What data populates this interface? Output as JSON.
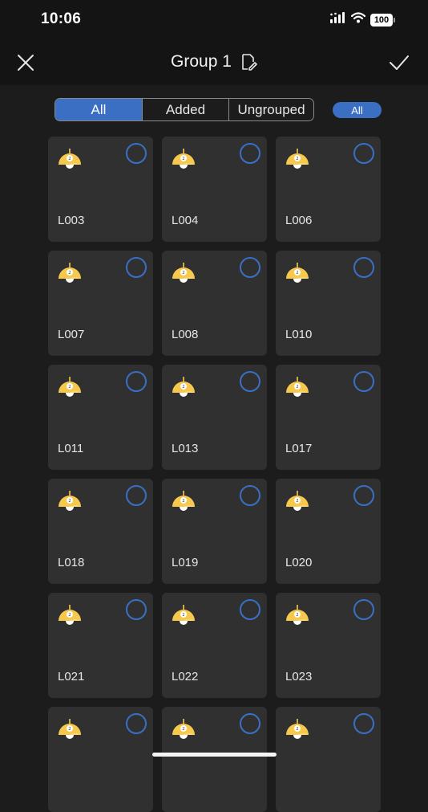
{
  "status_bar": {
    "time": "10:06",
    "battery": "100",
    "icons": [
      "signal-icon",
      "wifi-icon",
      "battery-icon"
    ]
  },
  "header": {
    "title": "Group 1",
    "left_icon": "close-icon",
    "title_icon": "edit-icon",
    "right_icon": "check-icon"
  },
  "filter": {
    "tabs": [
      {
        "label": "All",
        "active": true
      },
      {
        "label": "Added",
        "active": false
      },
      {
        "label": "Ungrouped",
        "active": false
      }
    ],
    "scope_label": "All"
  },
  "devices": [
    {
      "name": "L003",
      "selected": false
    },
    {
      "name": "L004",
      "selected": false
    },
    {
      "name": "L006",
      "selected": false
    },
    {
      "name": "L007",
      "selected": false
    },
    {
      "name": "L008",
      "selected": false
    },
    {
      "name": "L010",
      "selected": false
    },
    {
      "name": "L011",
      "selected": false
    },
    {
      "name": "L013",
      "selected": false
    },
    {
      "name": "L017",
      "selected": false
    },
    {
      "name": "L018",
      "selected": false
    },
    {
      "name": "L019",
      "selected": false
    },
    {
      "name": "L020",
      "selected": false
    },
    {
      "name": "L021",
      "selected": false
    },
    {
      "name": "L022",
      "selected": false
    },
    {
      "name": "L023",
      "selected": false
    },
    {
      "name": "",
      "selected": false
    },
    {
      "name": "",
      "selected": false
    },
    {
      "name": "",
      "selected": false
    }
  ],
  "colors": {
    "accent": "#3a6fc4",
    "background": "#1c1c1c",
    "card": "#303030",
    "lamp_yellow": "#f6c84c"
  }
}
